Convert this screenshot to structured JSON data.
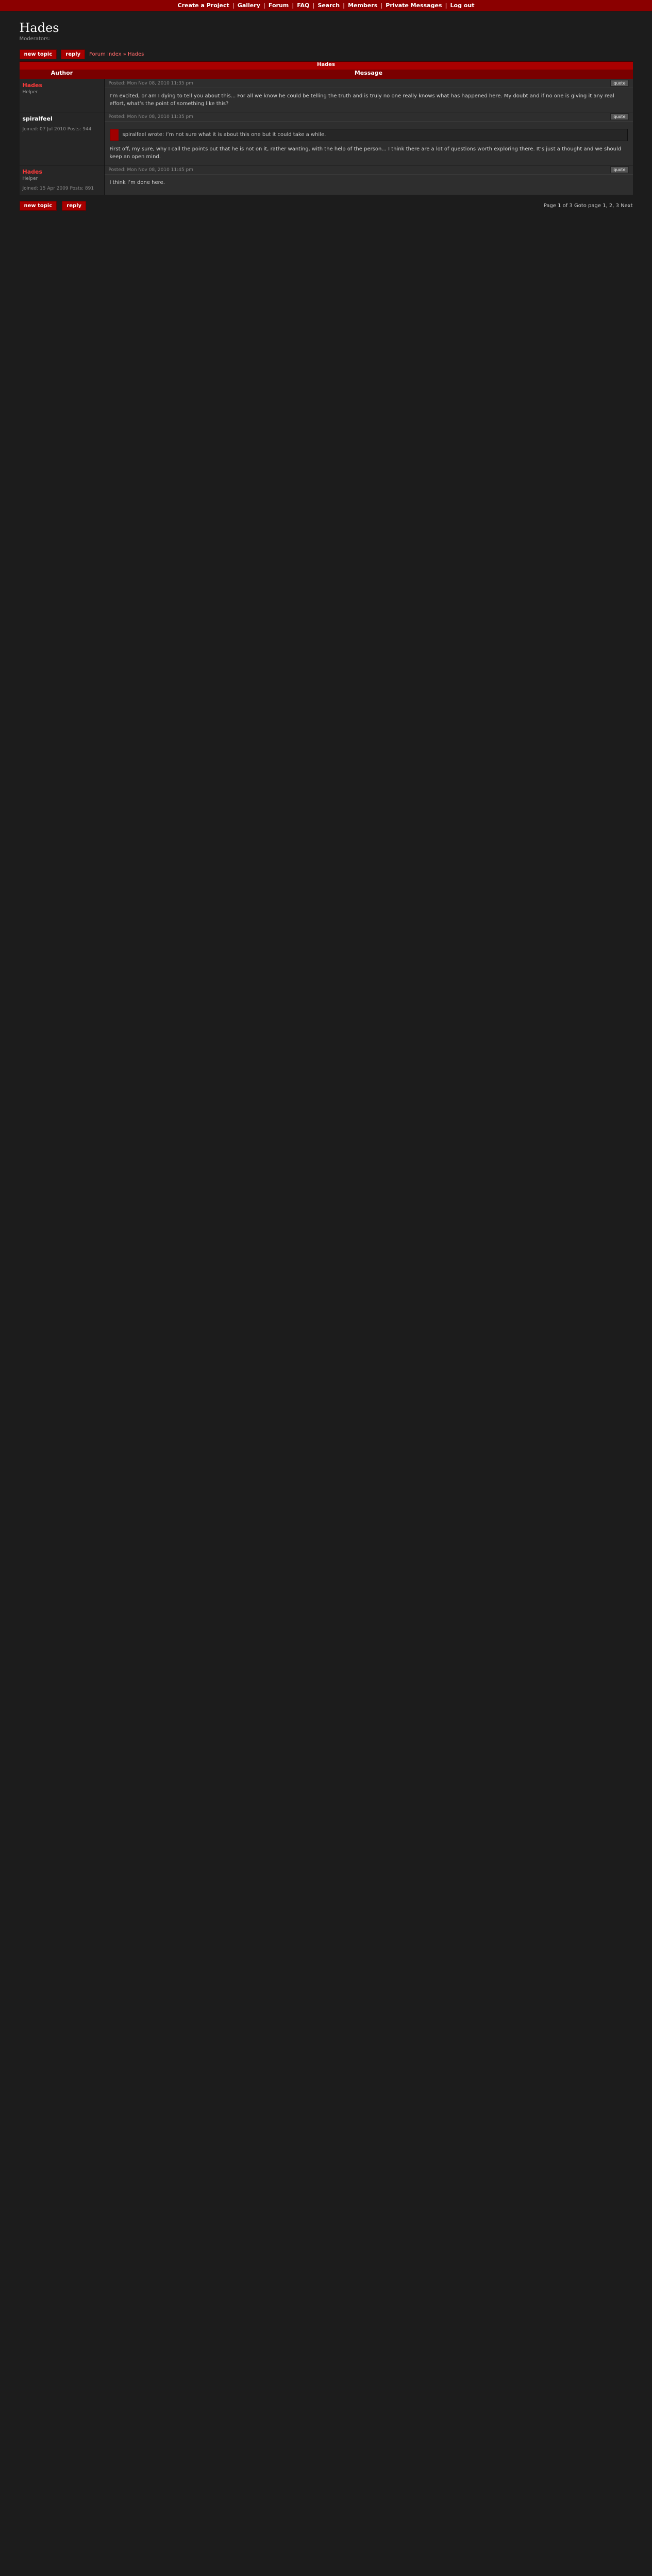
{
  "topnav": [
    "Create a Project",
    "Gallery",
    "Forum",
    "FAQ",
    "Search",
    "Members",
    "Private Messages",
    "Log out"
  ],
  "title": "Hades",
  "moderators_label": "Moderators:",
  "breadcrumbs": "Forum Index » Hades",
  "thread_title": "Hades",
  "columns": [
    "Author",
    "Message"
  ],
  "buttons": {
    "new_topic": "new topic",
    "reply": "reply"
  },
  "pagination": "Page 1 of 3 Goto page 1, 2, 3 Next",
  "posts": [
    {
      "author": "Hades",
      "rank": "Helper",
      "meta": "",
      "date": "Posted: Mon Nov 08, 2010 11:35 pm",
      "body": "I’m excited, or am I dying to tell you about this... For all we know he could be telling the truth and is truly no one really knows what has happened here. My doubt and if no one is giving it any real effort, what’s the point of something like this?"
    },
    {
      "author": "spiralfeel",
      "rank": "",
      "meta": "Joined: 07 Jul 2010 Posts: 944",
      "date": "Posted: Mon Nov 08, 2010 11:35 pm",
      "quote": "spiralfeel wrote: I’m not sure what it is about this one but it could take a while.",
      "body": "First off, my sure, why I call the points out that he is not on it, rather wanting, with the help of the person... I think there are a lot of questions worth exploring there. It’s just a thought and we should keep an open mind."
    },
    {
      "author": "Hades",
      "rank": "Helper",
      "meta": "Joined: 15 Apr 2009 Posts: 891",
      "date": "Posted: Mon Nov 08, 2010 11:45 pm",
      "body": "I think I’m done here."
    }
  ]
}
